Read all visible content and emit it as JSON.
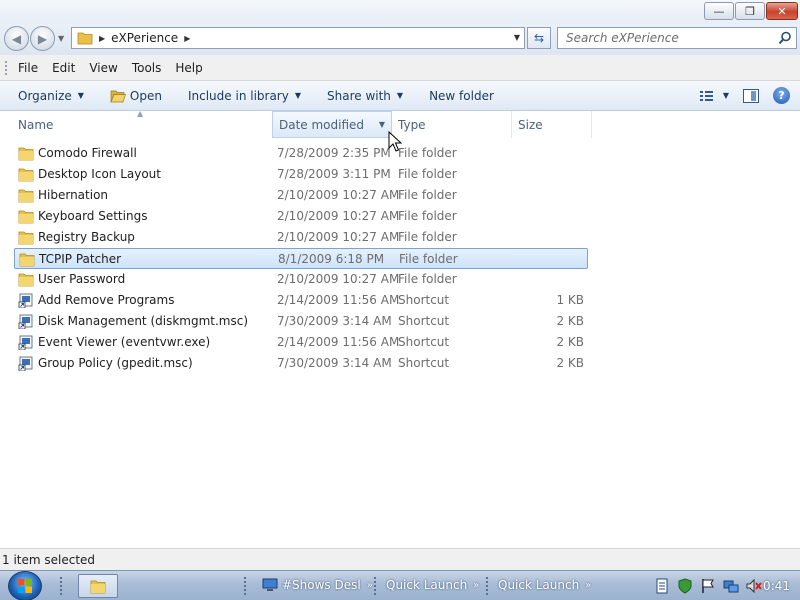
{
  "window": {
    "buttons": {
      "minimize": "—",
      "maximize": "❐",
      "close": "✕"
    }
  },
  "address": {
    "path": [
      "eXPerience"
    ],
    "search_placeholder": "Search eXPerience"
  },
  "menu": {
    "items": [
      "File",
      "Edit",
      "View",
      "Tools",
      "Help"
    ]
  },
  "toolbar": {
    "organize": "Organize",
    "open": "Open",
    "include_in_library": "Include in library",
    "share_with": "Share with",
    "new_folder": "New folder"
  },
  "columns": {
    "name": "Name",
    "date": "Date modified",
    "type": "Type",
    "size": "Size"
  },
  "files": [
    {
      "name": "Comodo Firewall",
      "date": "7/28/2009 2:35 PM",
      "type": "File folder",
      "size": "",
      "icon": "folder-icon",
      "selected": false
    },
    {
      "name": "Desktop Icon Layout",
      "date": "7/28/2009 3:11 PM",
      "type": "File folder",
      "size": "",
      "icon": "folder-icon",
      "selected": false
    },
    {
      "name": "Hibernation",
      "date": "2/10/2009 10:27 AM",
      "type": "File folder",
      "size": "",
      "icon": "folder-icon",
      "selected": false
    },
    {
      "name": "Keyboard Settings",
      "date": "2/10/2009 10:27 AM",
      "type": "File folder",
      "size": "",
      "icon": "folder-icon",
      "selected": false
    },
    {
      "name": "Registry Backup",
      "date": "2/10/2009 10:27 AM",
      "type": "File folder",
      "size": "",
      "icon": "folder-icon",
      "selected": false
    },
    {
      "name": "TCPIP Patcher",
      "date": "8/1/2009 6:18 PM",
      "type": "File folder",
      "size": "",
      "icon": "folder-icon",
      "selected": true
    },
    {
      "name": "User Password",
      "date": "2/10/2009 10:27 AM",
      "type": "File folder",
      "size": "",
      "icon": "folder-icon",
      "selected": false
    },
    {
      "name": "Add Remove Programs",
      "date": "2/14/2009 11:56 AM",
      "type": "Shortcut",
      "size": "1 KB",
      "icon": "shortcut-icon",
      "selected": false
    },
    {
      "name": "Disk Management (diskmgmt.msc)",
      "date": "7/30/2009 3:14 AM",
      "type": "Shortcut",
      "size": "2 KB",
      "icon": "shortcut-icon",
      "selected": false
    },
    {
      "name": "Event Viewer (eventvwr.exe)",
      "date": "2/14/2009 11:56 AM",
      "type": "Shortcut",
      "size": "2 KB",
      "icon": "shortcut-icon",
      "selected": false
    },
    {
      "name": "Group Policy (gpedit.msc)",
      "date": "7/30/2009 3:14 AM",
      "type": "Shortcut",
      "size": "2 KB",
      "icon": "shortcut-icon",
      "selected": false
    }
  ],
  "status": {
    "text": "1 item selected"
  },
  "taskbar": {
    "items": [
      "#Shows Desl",
      "Quick Launch",
      "Quick Launch"
    ],
    "clock": "0:41"
  },
  "colors": {
    "selection_fill": "#cde3fb",
    "selection_border": "#7da2ce",
    "folder_yellow": "#e8c04a",
    "toolbar_text": "#1e395b"
  }
}
